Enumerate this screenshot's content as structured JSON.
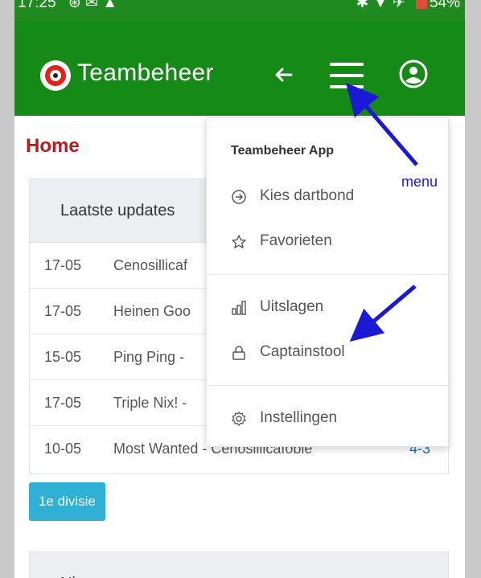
{
  "status_bar": {
    "time": "17:25",
    "battery": "54%"
  },
  "app_bar": {
    "brand": "Teambeheer"
  },
  "page": {
    "title": "Home"
  },
  "updates_card": {
    "header": "Laatste updates",
    "rows": [
      {
        "date": "17-05",
        "match": "Cenosillicaf",
        "score": ""
      },
      {
        "date": "17-05",
        "match": "Heinen Goo",
        "score": ""
      },
      {
        "date": "15-05",
        "match": "Ping Ping -",
        "score": ""
      },
      {
        "date": "17-05",
        "match": "Triple Nix! -",
        "score": ""
      },
      {
        "date": "10-05",
        "match": "Most Wanted - Cenosillicafobie",
        "score": "4-3"
      }
    ]
  },
  "division_badge": "1e divisie",
  "next_card": {
    "header": "Ni"
  },
  "menu": {
    "header": "Teambeheer App",
    "items": [
      {
        "label": "Kies dartbond",
        "icon": "arrow-circle-right-icon"
      },
      {
        "label": "Favorieten",
        "icon": "star-outline-icon"
      },
      {
        "label": "Uitslagen",
        "icon": "bar-chart-icon"
      },
      {
        "label": "Captainstool",
        "icon": "lock-icon"
      },
      {
        "label": "Instellingen",
        "icon": "gear-icon"
      }
    ]
  },
  "annotations": {
    "menu_label": "menu"
  },
  "colors": {
    "app_bar": "#168a16",
    "title_red": "#b71c1c",
    "badge_blue": "#31b0d5",
    "annotation_blue": "#1a1ad6"
  }
}
